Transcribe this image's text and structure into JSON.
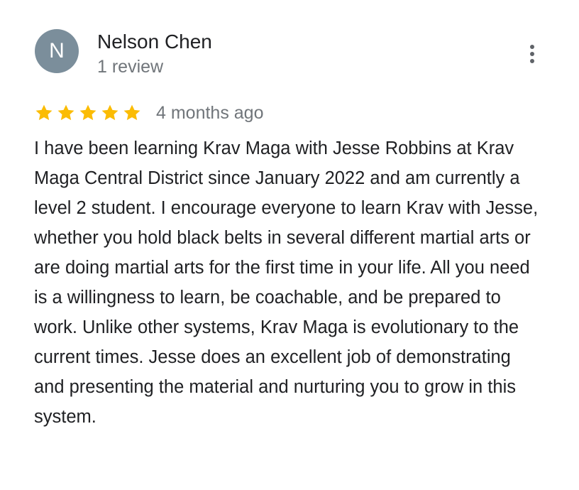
{
  "review": {
    "avatar_initial": "N",
    "avatar_color": "#7b8e9b",
    "reviewer_name": "Nelson Chen",
    "reviewer_meta": "1 review",
    "rating": 5,
    "rating_max": 5,
    "star_color": "#fbbc04",
    "date": "4 months ago",
    "text": "I have been learning Krav Maga with Jesse Robbins at Krav Maga Central District since January 2022 and am currently a level 2 student. I encourage everyone to learn Krav with Jesse, whether you hold black belts in several different martial arts or are doing martial arts for the first time in your life. All you need is a willingness to learn, be coachable, and be prepared to work. Unlike other systems, Krav Maga is evolutionary to the current times. Jesse does an excellent job of demonstrating and presenting the material and nurturing you to grow in this system."
  },
  "icons": {
    "more": "more-vertical-icon",
    "star": "star-icon"
  }
}
